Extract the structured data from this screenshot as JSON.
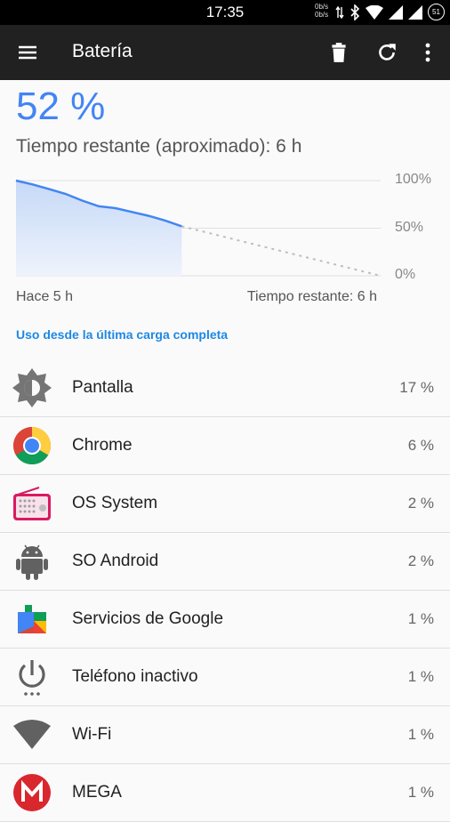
{
  "status_bar": {
    "time": "17:35",
    "net_up": "0b/s",
    "net_down": "0b/s",
    "battery_level": "51"
  },
  "app_bar": {
    "title": "Batería"
  },
  "battery": {
    "percent": "52 %",
    "remaining": "Tiempo restante (aproximado): 6 h"
  },
  "chart_data": {
    "type": "line",
    "y_ticks": [
      "100%",
      "50%",
      "0%"
    ],
    "ylim": [
      0,
      100
    ],
    "x_start_label": "Hace 5 h",
    "x_end_label": "Tiempo restante: 6 h",
    "series": [
      {
        "x": [
          0,
          0.5,
          1,
          1.5,
          2,
          2.5,
          3,
          3.5,
          4,
          4.5,
          5
        ],
        "values": [
          100,
          96,
          91,
          86,
          79,
          73,
          71,
          67,
          63,
          58,
          52
        ]
      }
    ],
    "projection": {
      "x": [
        5,
        11
      ],
      "values": [
        52,
        0
      ]
    }
  },
  "section_title": "Uso desde la última carga completa",
  "items": [
    {
      "name": "Pantalla",
      "value": "17 %",
      "icon": "brightness-icon"
    },
    {
      "name": "Chrome",
      "value": "6 %",
      "icon": "chrome-icon"
    },
    {
      "name": "OS System",
      "value": "2 %",
      "icon": "radio-icon"
    },
    {
      "name": "SO Android",
      "value": "2 %",
      "icon": "android-icon"
    },
    {
      "name": "Servicios de Google",
      "value": "1 %",
      "icon": "google-play-services-icon"
    },
    {
      "name": "Teléfono inactivo",
      "value": "1 %",
      "icon": "power-icon"
    },
    {
      "name": "Wi-Fi",
      "value": "1 %",
      "icon": "wifi-icon"
    },
    {
      "name": "MEGA",
      "value": "1 %",
      "icon": "mega-icon"
    }
  ],
  "colors": {
    "accent": "#4285f4",
    "appbar": "#212121",
    "section": "#1e88e5"
  }
}
